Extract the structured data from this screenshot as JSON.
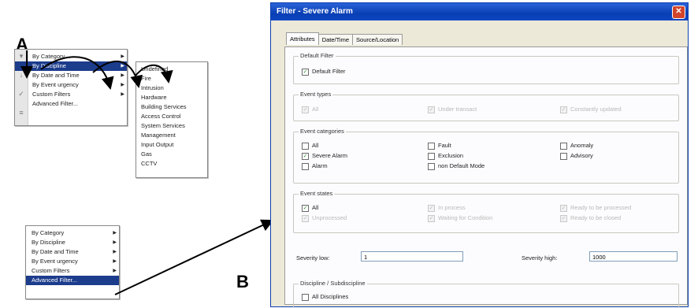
{
  "labels": {
    "a": "A",
    "b": "B"
  },
  "menu1": {
    "items": [
      {
        "label": "By Category",
        "submenu": true,
        "selected": false
      },
      {
        "label": "By Discipline",
        "submenu": true,
        "selected": true
      },
      {
        "label": "By Date and Time",
        "submenu": true,
        "selected": false
      },
      {
        "label": "By Event urgency",
        "submenu": true,
        "selected": false
      },
      {
        "label": "Custom Filters",
        "submenu": true,
        "selected": false
      },
      {
        "label": "Advanced Filter...",
        "submenu": false,
        "selected": false
      }
    ]
  },
  "submenu": {
    "items": [
      "Undefined",
      "Fire",
      "Intrusion",
      "Hardware",
      "Building Services",
      "Access Control",
      "System Services",
      "Management",
      "Input Output",
      "Gas",
      "CCTV"
    ]
  },
  "menu2": {
    "items": [
      {
        "label": "By Category",
        "submenu": true,
        "selected": false
      },
      {
        "label": "By Discipline",
        "submenu": true,
        "selected": false
      },
      {
        "label": "By Date and Time",
        "submenu": true,
        "selected": false
      },
      {
        "label": "By Event urgency",
        "submenu": true,
        "selected": false
      },
      {
        "label": "Custom Filters",
        "submenu": true,
        "selected": false
      },
      {
        "label": "Advanced Filter...",
        "submenu": false,
        "selected": true
      }
    ]
  },
  "dialog": {
    "title": "Filter - Severe Alarm",
    "close_glyph": "✕",
    "tabs": [
      "Attributes",
      "Date/Time",
      "Source/Location"
    ],
    "default_filter": {
      "group_label": "Default Filter",
      "checkbox": "Default Filter",
      "checked": true
    },
    "event_types": {
      "group_label": "Event types",
      "items": [
        {
          "label": "All",
          "checked": true,
          "disabled": true
        },
        {
          "label": "Under transact",
          "checked": true,
          "disabled": true
        },
        {
          "label": "Constantly updated",
          "checked": true,
          "disabled": true
        }
      ]
    },
    "event_categories": {
      "group_label": "Event categories",
      "items": [
        {
          "label": "All",
          "checked": false
        },
        {
          "label": "Severe Alarm",
          "checked": true
        },
        {
          "label": "Alarm",
          "checked": false
        },
        {
          "label": "Fault",
          "checked": false
        },
        {
          "label": "Exclusion",
          "checked": false
        },
        {
          "label": "non Default Mode",
          "checked": false
        },
        {
          "label": "Anomaly",
          "checked": false
        },
        {
          "label": "Advisory",
          "checked": false
        }
      ]
    },
    "event_states": {
      "group_label": "Event states",
      "items": [
        {
          "label": "All",
          "checked": true,
          "disabled": false
        },
        {
          "label": "Unprocessed",
          "checked": true,
          "disabled": true
        },
        {
          "label": "In process",
          "checked": true,
          "disabled": true
        },
        {
          "label": "Waiting for Condition",
          "checked": true,
          "disabled": true
        },
        {
          "label": "Ready to be processed",
          "checked": true,
          "disabled": true
        },
        {
          "label": "Ready to be closed",
          "checked": true,
          "disabled": true
        }
      ]
    },
    "severity": {
      "low_label": "Severity low:",
      "low_value": "1",
      "high_label": "Severity high:",
      "high_value": "1000"
    },
    "discipline": {
      "group_label": "Discipline / Subdiscipline",
      "checkbox": "All Disciplines",
      "checked": false
    }
  }
}
